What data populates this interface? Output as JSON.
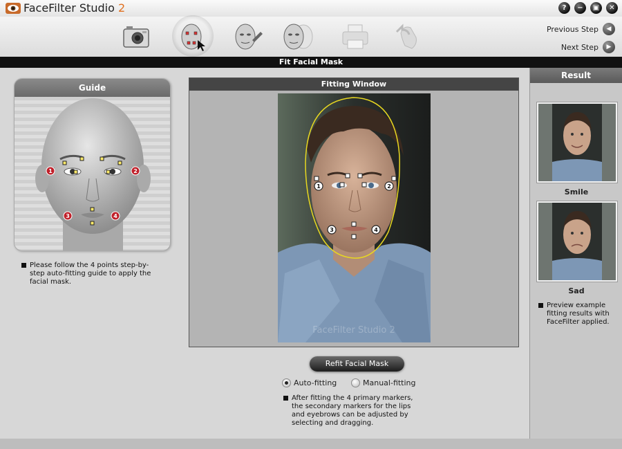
{
  "app": {
    "title": "FaceFilter Studio",
    "version": "2",
    "window_buttons": [
      {
        "name": "help-icon",
        "glyph": "?"
      },
      {
        "name": "minimize-icon",
        "glyph": "−"
      },
      {
        "name": "restore-icon",
        "glyph": "▣"
      },
      {
        "name": "close-icon",
        "glyph": "✕"
      }
    ]
  },
  "toolbar": {
    "tools": [
      {
        "name": "camera-icon",
        "active": false
      },
      {
        "name": "fit-mask-icon",
        "active": true
      },
      {
        "name": "edit-face-icon",
        "active": false
      },
      {
        "name": "morph-faces-icon",
        "active": false
      },
      {
        "name": "printer-icon",
        "active": false
      },
      {
        "name": "share-hand-icon",
        "active": false
      }
    ],
    "previous_step": "Previous Step",
    "next_step": "Next Step"
  },
  "step": {
    "title": "Fit Facial Mask"
  },
  "guide": {
    "title": "Guide",
    "markers": [
      "1",
      "2",
      "3",
      "4"
    ],
    "note": "Please follow the 4 points step-by-step auto-fitting guide to apply the facial mask."
  },
  "fitting": {
    "title": "Fitting Window",
    "watermark": "FaceFilter Studio 2",
    "markers": [
      "1",
      "2",
      "3",
      "4"
    ],
    "refit_button": "Refit Facial Mask",
    "modes": [
      {
        "label": "Auto-fitting",
        "selected": true
      },
      {
        "label": "Manual-fitting",
        "selected": false
      }
    ],
    "note": "After fitting the 4 primary markers, the secondary markers for the lips and eyebrows can be adjusted by selecting and dragging."
  },
  "result": {
    "title": "Result",
    "thumbs": [
      {
        "label": "Smile"
      },
      {
        "label": "Sad"
      }
    ],
    "note": "Preview example fitting results with FaceFilter applied."
  },
  "colors": {
    "accent_orange": "#e07020",
    "marker_red": "#c0202a",
    "mask_yellow": "#e8d820"
  }
}
